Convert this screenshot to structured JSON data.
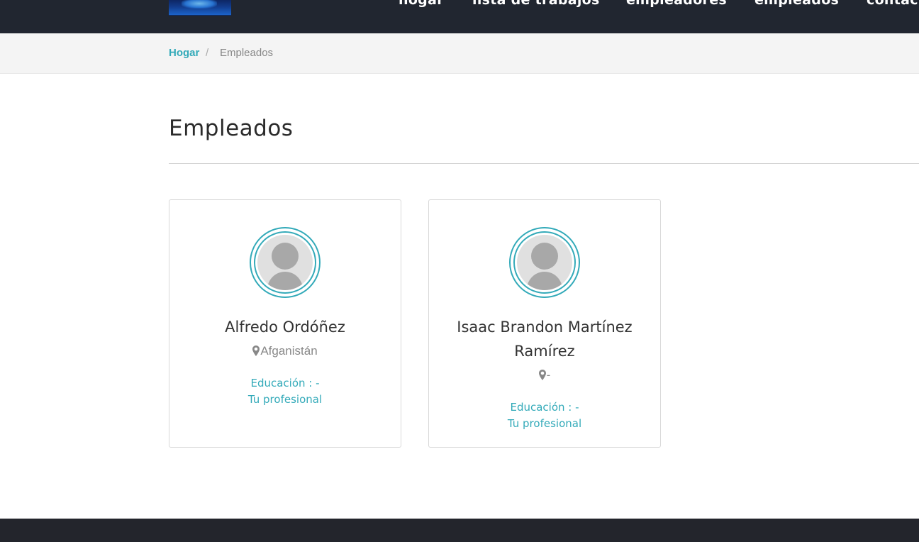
{
  "nav": {
    "items": [
      {
        "label": "hogar"
      },
      {
        "label": "lista de trabajos"
      },
      {
        "label": "empleadores"
      },
      {
        "label": "empleados"
      },
      {
        "label": "contacto"
      }
    ]
  },
  "breadcrumb": {
    "home": "Hogar",
    "separator": "/",
    "current": "Empleados"
  },
  "page": {
    "title": "Empleados"
  },
  "employees": [
    {
      "name": "Alfredo Ordóñez",
      "location": "Afganistán",
      "education": "Educación : -",
      "profession": "Tu profesional"
    },
    {
      "name": "Isaac Brandon Martínez Ramírez",
      "location": "-",
      "education": "Educación : -",
      "profession": "Tu profesional"
    }
  ],
  "colors": {
    "accent": "#33aab9",
    "nav_bg": "#212630",
    "footer_bg": "#23252c",
    "crumb_bg": "#f4f4f4"
  },
  "icons": {
    "location": "map-marker-icon",
    "avatar": "user-placeholder-icon"
  }
}
